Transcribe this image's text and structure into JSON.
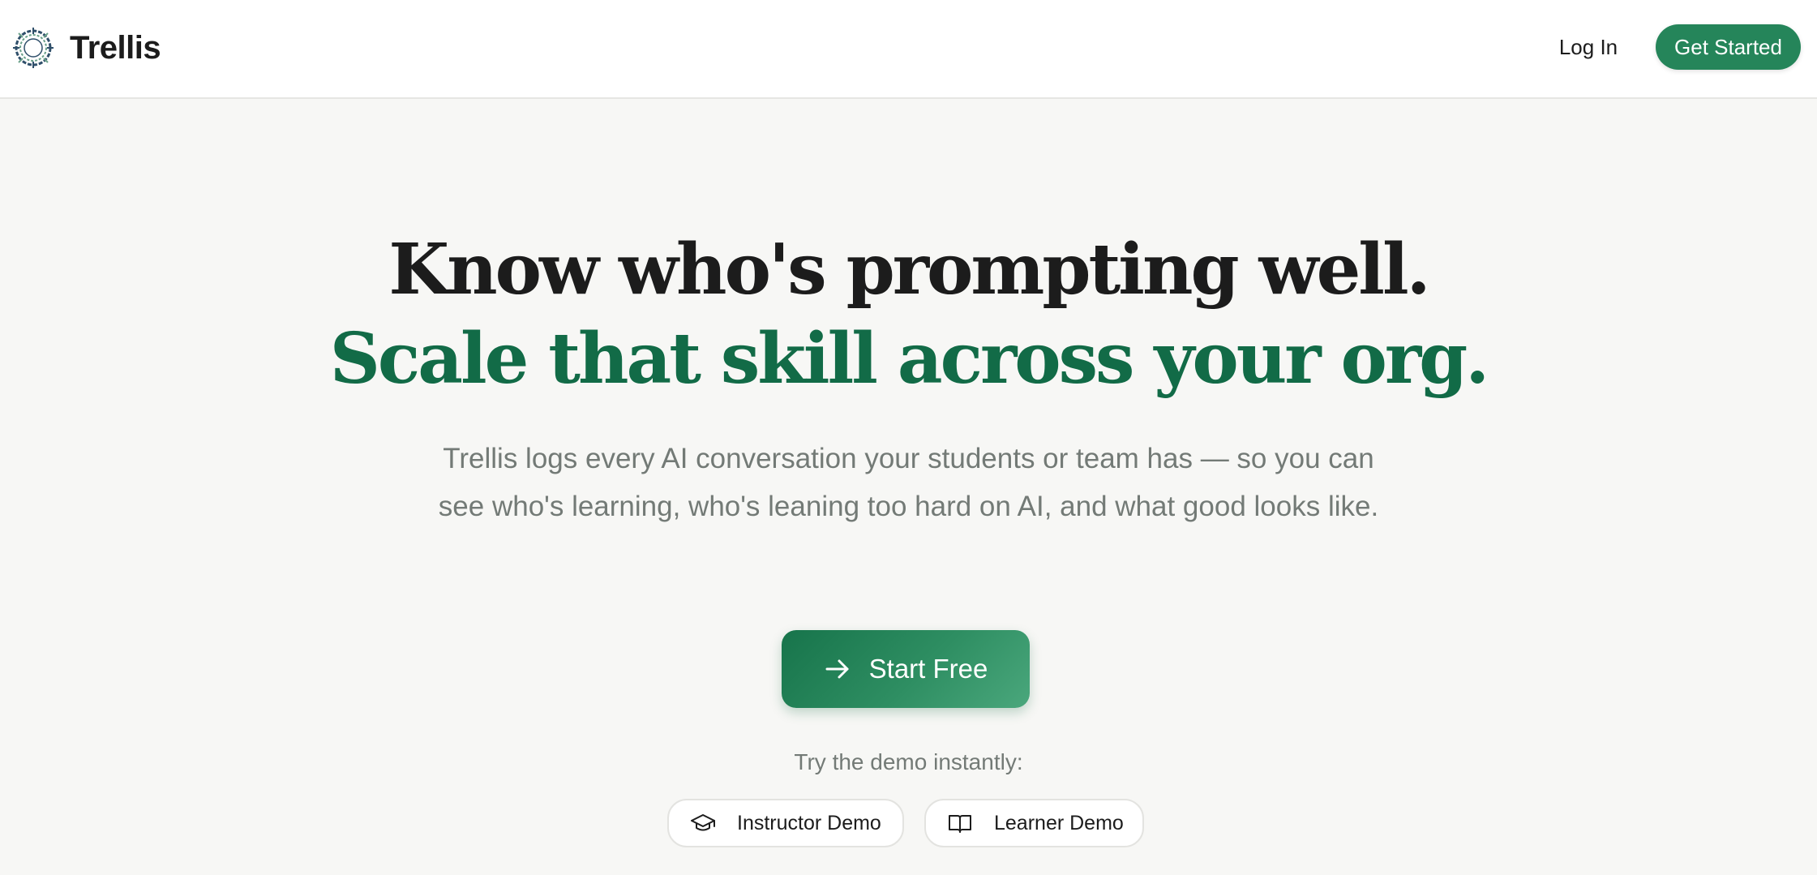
{
  "brand": {
    "name": "Trellis",
    "logo_icon": "trellis-ring-logo-icon"
  },
  "nav": {
    "login_label": "Log In",
    "get_started_label": "Get Started"
  },
  "hero": {
    "headline_line1": "Know who's prompting well.",
    "headline_line2": "Scale that skill across your org.",
    "subtitle": "Trellis logs every AI conversation your students or team has — so you can see who's learning, who's leaning too hard on AI, and what good looks like.",
    "cta_label": "Start Free",
    "cta_icon": "arrow-right-icon"
  },
  "demo": {
    "caption": "Try the demo instantly:",
    "instructor_label": "Instructor Demo",
    "instructor_icon": "graduation-cap-icon",
    "learner_label": "Learner Demo",
    "learner_icon": "open-book-icon"
  },
  "colors": {
    "accent_green": "#25855a",
    "headline_green": "#126b47",
    "page_background": "#f7f7f5",
    "muted_text": "#737a76"
  }
}
